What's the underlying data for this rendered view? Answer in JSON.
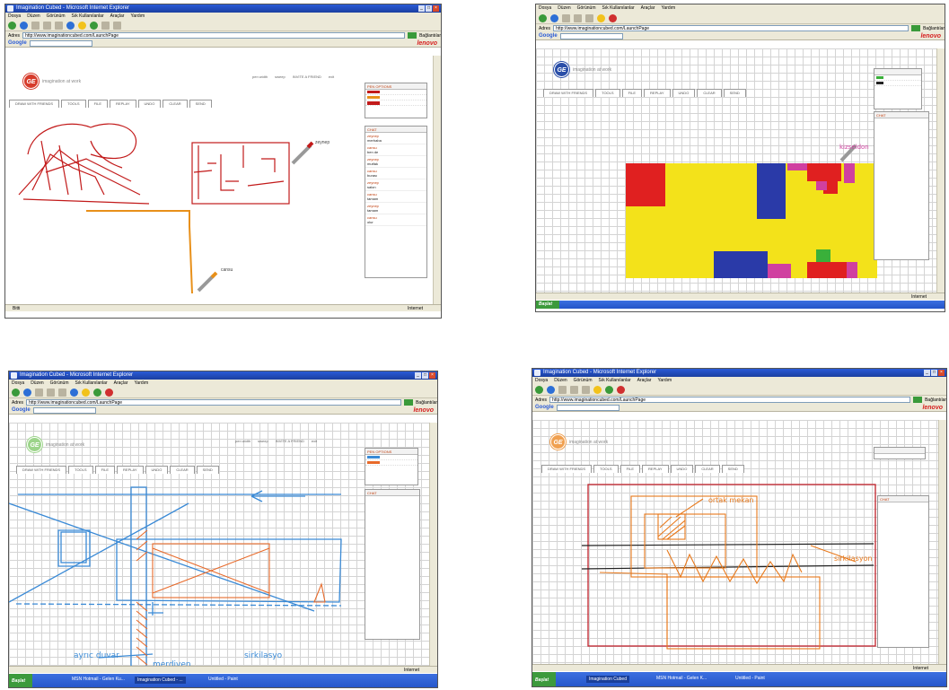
{
  "shots": [
    {
      "window_title": "Imagination Cubed - Microsoft Internet Explorer",
      "menu": [
        "Dosya",
        "Düzen",
        "Görünüm",
        "Sık Kullanılanlar",
        "Araçlar",
        "Yardım"
      ],
      "address": "http://www.imaginationcubed.com/LaunchPage",
      "links_label": "Bağlantılar",
      "logo_text": "imagination at work",
      "top_actions": [
        "pen width",
        "sweep",
        "INVITE A FRIEND",
        "exit"
      ],
      "tabs": [
        "DRAW WITH FRIENDS",
        "TOOLS",
        "FILE",
        "REPLAY",
        "UNDO",
        "CLEAR",
        "SEND"
      ],
      "pen_panel_title": "PEN OPTIONS",
      "chat_title": "CHAT",
      "chat_messages": [
        {
          "who": "zeynep",
          "text": "merhaba"
        },
        {
          "who": "cansu",
          "text": "ben de"
        },
        {
          "who": "zeynep",
          "text": "mutfak"
        },
        {
          "who": "cansu",
          "text": "burası"
        },
        {
          "who": "zeynep",
          "text": "salon"
        },
        {
          "who": "cansu",
          "text": "tamam"
        },
        {
          "who": "zeynep",
          "text": "tamam"
        },
        {
          "who": "cansu",
          "text": "olur"
        }
      ],
      "labels": [
        "zeynep",
        "cansu"
      ],
      "status": "Bitti",
      "zone": "Internet"
    },
    {
      "window_title": "Imagination Cubed - Microsoft Internet Explorer",
      "menu": [
        "Dosya",
        "Düzen",
        "Görünüm",
        "Sık Kullanılanlar",
        "Araçlar",
        "Yardım"
      ],
      "address": "http://www.imaginationcubed.com/LaunchPage",
      "links_label": "Bağlantılar",
      "logo_text": "imagination at work",
      "tabs": [
        "DRAW WITH FRIENDS",
        "TOOLS",
        "FILE",
        "REPLAY",
        "UNDO",
        "CLEAR",
        "SEND"
      ],
      "chat_title": "CHAT",
      "labels": [
        "kizseldon"
      ],
      "zone": "Internet"
    },
    {
      "window_title": "Imagination Cubed - Microsoft Internet Explorer",
      "menu": [
        "Dosya",
        "Düzen",
        "Görünüm",
        "Sık Kullanılanlar",
        "Araçlar",
        "Yardım"
      ],
      "address": "http://www.imaginationcubed.com/LaunchPage",
      "links_label": "Bağlantılar",
      "logo_text": "imagination at work",
      "top_actions": [
        "pen width",
        "sweep",
        "INVITE A FRIEND",
        "exit"
      ],
      "tabs": [
        "DRAW WITH FRIENDS",
        "TOOLS",
        "FILE",
        "REPLAY",
        "UNDO",
        "CLEAR",
        "SEND"
      ],
      "pen_panel_title": "PEN OPTIONS",
      "chat_title": "CHAT",
      "labels": [
        "ayrıc duvar",
        "merdiven",
        "sirkilasyo"
      ],
      "taskbar_items": [
        "MSN Hotmail - Gelen Ku...",
        "Imagination Cubed - ...",
        "Untitled - Paint"
      ],
      "zone": "Internet"
    },
    {
      "window_title": "Imagination Cubed - Microsoft Internet Explorer",
      "menu": [
        "Dosya",
        "Düzen",
        "Görünüm",
        "Sık Kullanılanlar",
        "Araçlar",
        "Yardım"
      ],
      "address": "http://www.imaginationcubed.com/LaunchPage",
      "links_label": "Bağlantılar",
      "logo_text": "imagination at work",
      "tabs": [
        "DRAW WITH FRIENDS",
        "TOOLS",
        "FILE",
        "REPLAY",
        "UNDO",
        "CLEAR",
        "SEND"
      ],
      "chat_title": "CHAT",
      "labels": [
        "ortak mekan",
        "sirkilasyon"
      ],
      "taskbar_items": [
        "Imagination Cubed",
        "MSN Hotmail - Gelen K...",
        "Untitled - Paint"
      ],
      "zone": "Internet"
    }
  ]
}
